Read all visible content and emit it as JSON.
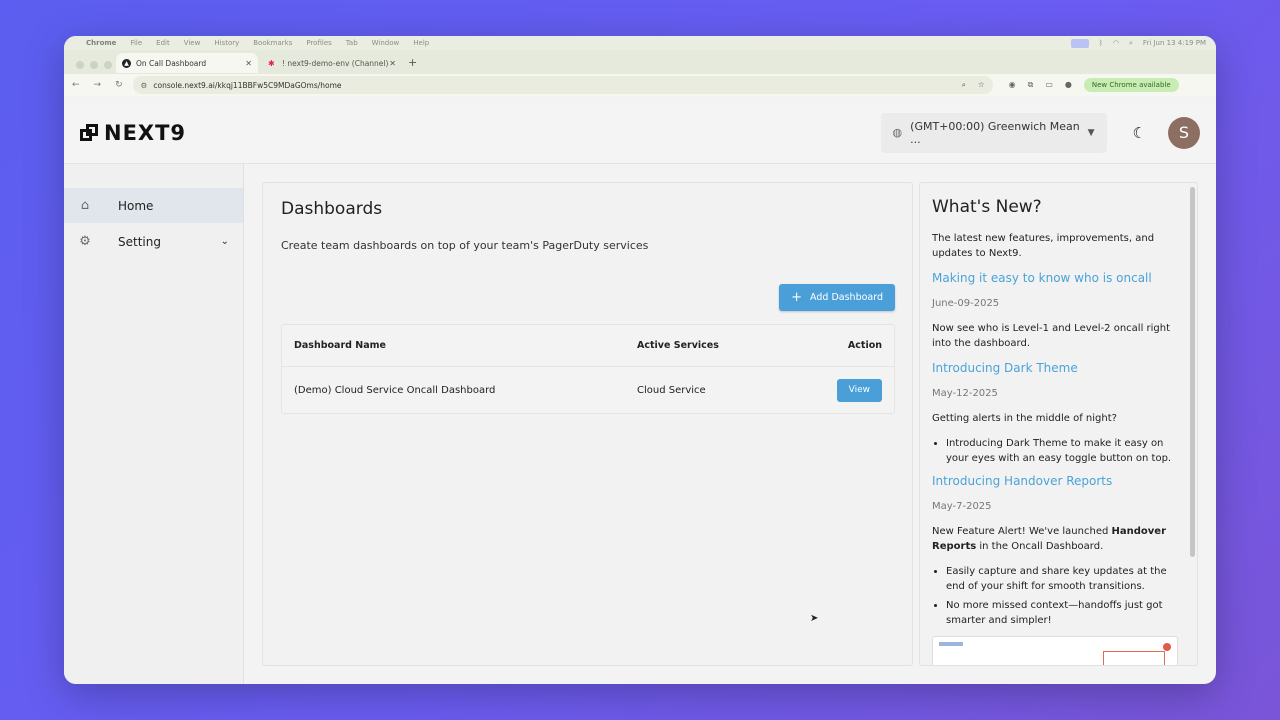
{
  "menubar": {
    "app": "Chrome",
    "items": [
      "File",
      "Edit",
      "View",
      "History",
      "Bookmarks",
      "Profiles",
      "Tab",
      "Window",
      "Help"
    ],
    "clock": "Fri Jun 13  4:19 PM"
  },
  "tabs": [
    {
      "title": "On Call Dashboard",
      "active": true
    },
    {
      "title": "! next9-demo-env (Channel)",
      "active": false
    }
  ],
  "addressbar": {
    "url": "console.next9.ai/kkqj11BBFw5C9MDaGOms/home",
    "update_label": "New Chrome available"
  },
  "header": {
    "logo": "NEXT9",
    "timezone": "(GMT+00:00) Greenwich Mean ...",
    "avatar_letter": "S"
  },
  "sidebar": {
    "items": [
      {
        "label": "Home",
        "icon": "home-icon",
        "active": true
      },
      {
        "label": "Setting",
        "icon": "gear-icon",
        "active": false
      }
    ]
  },
  "main": {
    "title": "Dashboards",
    "description": "Create team dashboards on top of your team's PagerDuty services",
    "add_button": "Add Dashboard",
    "table": {
      "headers": [
        "Dashboard Name",
        "Active Services",
        "Action"
      ],
      "rows": [
        {
          "name": "(Demo) Cloud Service Oncall Dashboard",
          "services": "Cloud Service",
          "action": "View"
        }
      ]
    }
  },
  "whats_new": {
    "title": "What's New?",
    "intro": "The latest new features, improvements, and updates to Next9.",
    "entries": [
      {
        "title": "Making it easy to know who is oncall",
        "date": "June-09-2025",
        "body": "Now see who is Level-1 and Level-2 oncall right into the dashboard."
      },
      {
        "title": "Introducing Dark Theme",
        "date": "May-12-2025",
        "body": "Getting alerts in the middle of night?",
        "bullets": [
          "Introducing Dark Theme to make it easy on your eyes with an easy toggle button on top."
        ]
      },
      {
        "title": "Introducing Handover Reports",
        "date": "May-7-2025",
        "body_pre": "New Feature Alert! We've launched ",
        "body_bold": "Handover Reports",
        "body_post": " in the Oncall Dashboard.",
        "bullets": [
          "Easily capture and share key updates at the end of your shift for smooth transitions.",
          "No more missed context—handoffs just got smarter and simpler!"
        ]
      }
    ]
  },
  "colors": {
    "accent": "#4a9fd8",
    "link": "#4aa3d9",
    "avatar": "#8d6e63",
    "background_gradient_start": "#5b5ef0",
    "background_gradient_end": "#7a55d8"
  }
}
